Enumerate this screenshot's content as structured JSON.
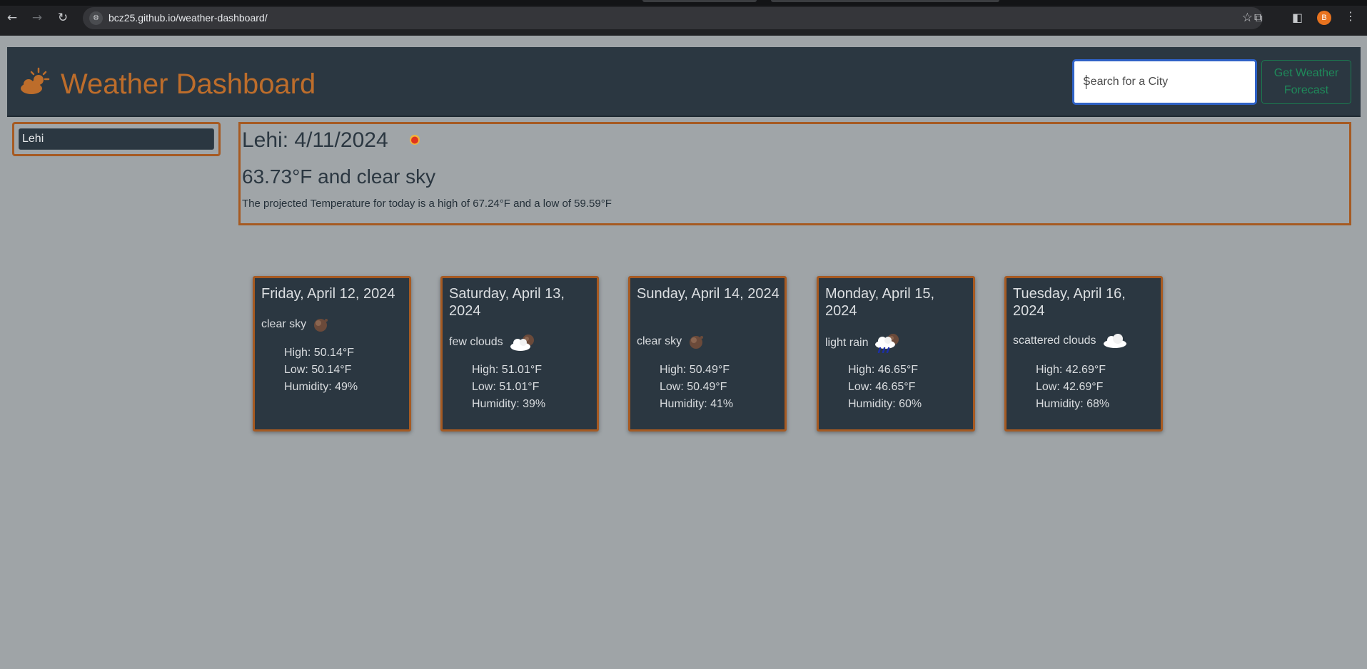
{
  "browser": {
    "url": "bcz25.github.io/weather-dashboard/",
    "profile_initial": "B"
  },
  "header": {
    "title": "Weather Dashboard",
    "search_placeholder": "Search for a City",
    "forecast_button": "Get Weather Forecast"
  },
  "history": [
    "Lehi"
  ],
  "current": {
    "heading": "Lehi: 4/11/2024",
    "temp_line": "63.73°F and clear sky",
    "projection": "The projected Temperature for today is a high of 67.24°F and a low of 59.59°F",
    "icon": "clear-night-icon"
  },
  "forecast": [
    {
      "date": "Friday, April 12, 2024",
      "condition": "clear sky",
      "icon": "moon-icon",
      "high": "High: 50.14°F",
      "low": "Low: 50.14°F",
      "humidity": "Humidity: 49%"
    },
    {
      "date": "Saturday, April 13, 2024",
      "condition": "few clouds",
      "icon": "cloud-moon-icon",
      "high": "High: 51.01°F",
      "low": "Low: 51.01°F",
      "humidity": "Humidity: 39%"
    },
    {
      "date": "Sunday, April 14, 2024",
      "condition": "clear sky",
      "icon": "moon-icon",
      "high": "High: 50.49°F",
      "low": "Low: 50.49°F",
      "humidity": "Humidity: 41%"
    },
    {
      "date": "Monday, April 15, 2024",
      "condition": "light rain",
      "icon": "rain-icon",
      "high": "High: 46.65°F",
      "low": "Low: 46.65°F",
      "humidity": "Humidity: 60%"
    },
    {
      "date": "Tuesday, April 16, 2024",
      "condition": "scattered clouds",
      "icon": "cloud-icon",
      "high": "High: 42.69°F",
      "low": "Low: 42.69°F",
      "humidity": "Humidity: 68%"
    }
  ],
  "colors": {
    "page_bg": "#9fa4a7",
    "panel_bg": "#2b3741",
    "accent": "#bd6d2b",
    "border": "#a65a22",
    "button_text": "#1f8a5a"
  }
}
